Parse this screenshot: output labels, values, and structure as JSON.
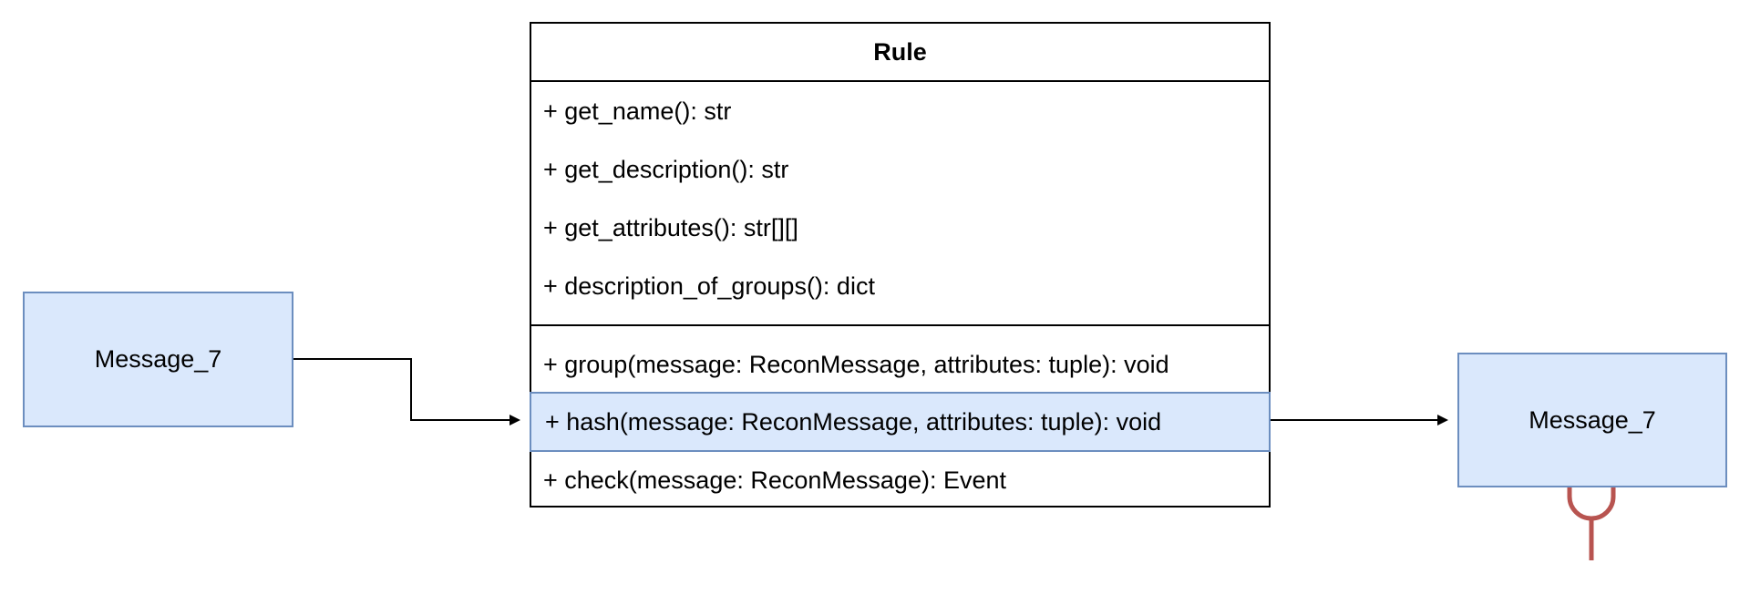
{
  "diagram": {
    "left_message": {
      "label": "Message_7"
    },
    "right_message": {
      "label": "Message_7"
    },
    "class": {
      "name": "Rule",
      "attributes": [
        "+ get_name(): str",
        "+ get_description(): str",
        "+ get_attributes(): str[][]",
        "+ description_of_groups(): dict"
      ],
      "methods": [
        "+ group(message: ReconMessage, attributes: tuple): void",
        "+ hash(message: ReconMessage, attributes: tuple): void",
        "+ check(message: ReconMessage): Event"
      ],
      "highlighted_method_index": 1
    },
    "colors": {
      "box_fill": "#dae8fc",
      "box_stroke": "#6c8ebf",
      "line": "#000000",
      "interface_symbol": "#b85450"
    }
  }
}
